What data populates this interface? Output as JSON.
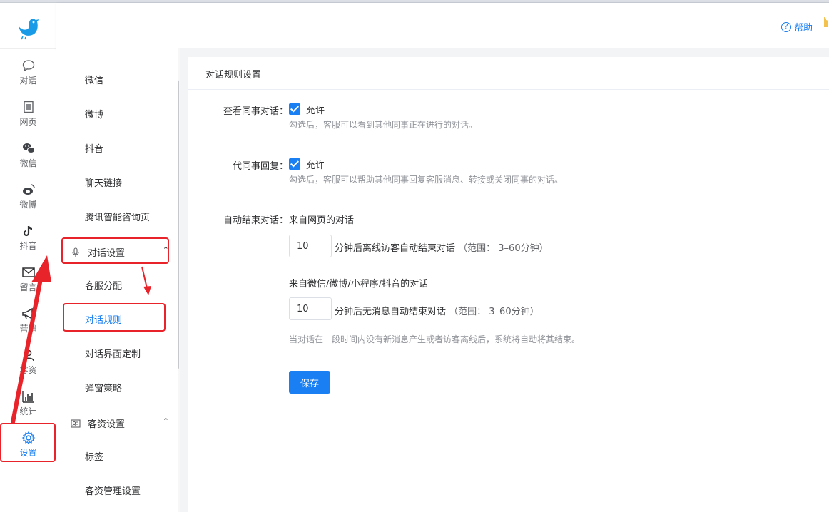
{
  "header": {
    "help_label": "帮助"
  },
  "rail": {
    "items": [
      {
        "label": "对话",
        "icon": "chat-bubble-icon"
      },
      {
        "label": "网页",
        "icon": "webpage-icon"
      },
      {
        "label": "微信",
        "icon": "wechat-icon"
      },
      {
        "label": "微博",
        "icon": "weibo-icon"
      },
      {
        "label": "抖音",
        "icon": "douyin-icon"
      },
      {
        "label": "留言",
        "icon": "mail-icon"
      },
      {
        "label": "营销",
        "icon": "megaphone-icon"
      },
      {
        "label": "客资",
        "icon": "user-icon"
      },
      {
        "label": "统计",
        "icon": "bar-chart-icon"
      },
      {
        "label": "设置",
        "icon": "gear-icon"
      }
    ],
    "active_color": "#1a7ff2"
  },
  "submenu": {
    "items_top": [
      "微信",
      "微博",
      "抖音",
      "聊天链接",
      "腾讯智能咨询页"
    ],
    "group1": {
      "label": "对话设置",
      "icon": "microphone-icon",
      "children": [
        "客服分配",
        "对话规则",
        "对话界面定制",
        "弹窗策略"
      ]
    },
    "group2": {
      "label": "客资设置",
      "icon": "contact-card-icon",
      "children": [
        "标签",
        "客资管理设置"
      ]
    }
  },
  "content": {
    "title": "对话规则设置",
    "view_colleague": {
      "label": "查看同事对话：",
      "option": "允许",
      "hint": "勾选后，客服可以看到其他同事正在进行的对话。"
    },
    "reply_for_colleague": {
      "label": "代同事回复：",
      "option": "允许",
      "hint": "勾选后，客服可以帮助其他同事回复客服消息、转接或关闭同事的对话。"
    },
    "auto_end": {
      "label": "自动结束对话：",
      "web_title": "来自网页的对话",
      "web_value": "10",
      "web_desc": "分钟后离线访客自动结束对话",
      "web_range": "（范围： 3–60分钟）",
      "social_title": "来自微信/微博/小程序/抖音的对话",
      "social_value": "10",
      "social_desc": "分钟后无消息自动结束对话",
      "social_range": "（范围： 3–60分钟）",
      "note": "当对话在一段时间内没有新消息产生或者访客离线后，系统将自动将其结束。"
    },
    "save_label": "保存"
  },
  "colors": {
    "accent": "#1a7ff2",
    "annotation_red": "#e8232a"
  }
}
